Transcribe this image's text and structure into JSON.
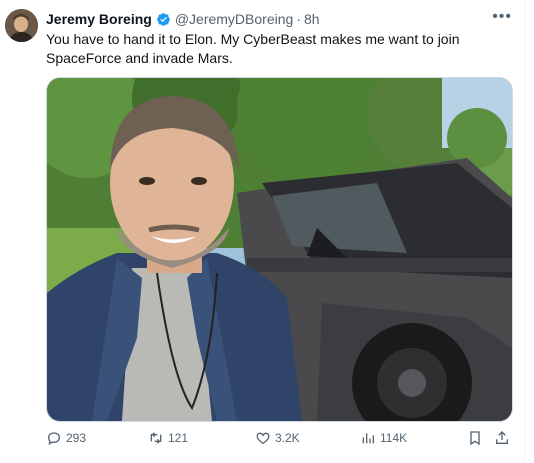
{
  "tweet": {
    "author_name": "Jeremy Boreing",
    "handle": "@JeremyDBoreing",
    "separator": "·",
    "time": "8h",
    "text": "You have to hand it to Elon. My CyberBeast makes me want to join SpaceForce and invade Mars.",
    "more_label": "•••"
  },
  "actions": {
    "replies": "293",
    "reposts": "121",
    "likes": "3.2K",
    "views": "114K"
  },
  "icons": {
    "verified": "verified-badge-icon",
    "reply": "reply-icon",
    "repost": "repost-icon",
    "like": "heart-icon",
    "views": "views-chart-icon",
    "bookmark": "bookmark-icon",
    "share": "share-icon"
  },
  "colors": {
    "verified": "#1d9bf0",
    "muted": "#536471",
    "text": "#0f1419"
  }
}
